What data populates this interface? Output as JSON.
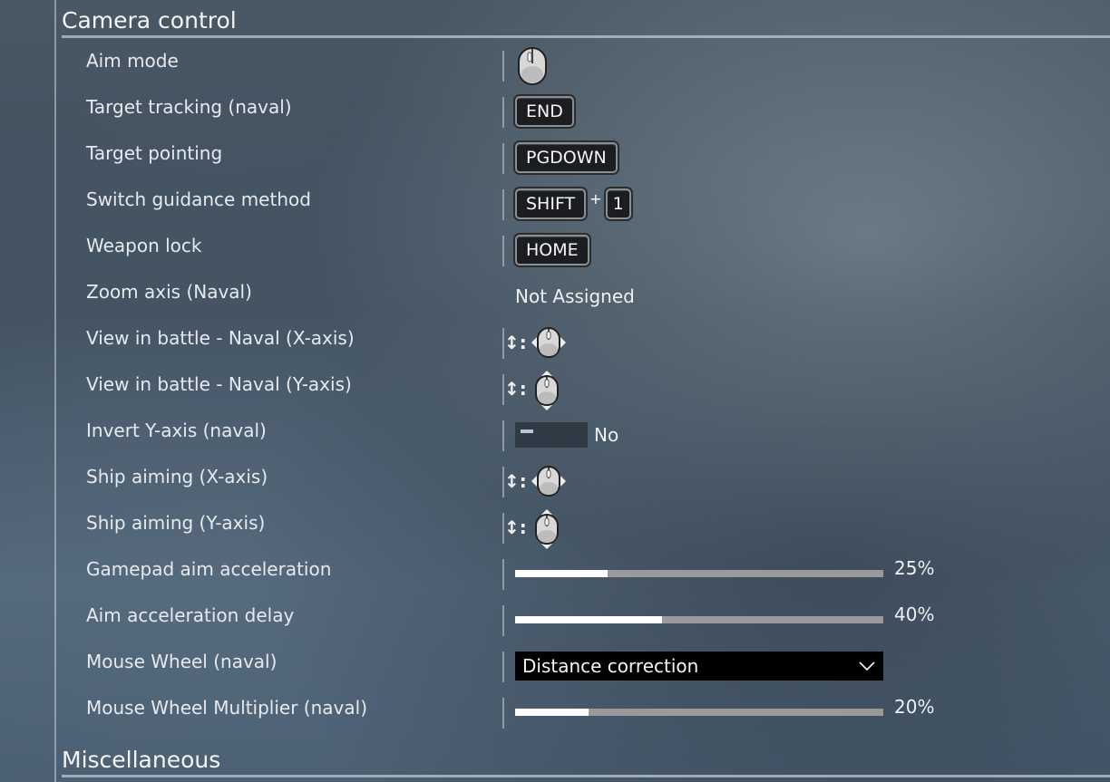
{
  "sections": {
    "camera_control": "Camera control",
    "miscellaneous": "Miscellaneous"
  },
  "rows": [
    {
      "label": "Aim mode",
      "type": "mouse",
      "icon": "mouse-icon"
    },
    {
      "label": "Target tracking (naval)",
      "type": "key",
      "keys": [
        "END"
      ]
    },
    {
      "label": "Target pointing",
      "type": "key",
      "keys": [
        "PGDOWN"
      ]
    },
    {
      "label": "Switch guidance method",
      "type": "combo",
      "keys": [
        "SHIFT",
        "1"
      ],
      "plus": "+"
    },
    {
      "label": "Weapon lock",
      "type": "key",
      "keys": [
        "HOME"
      ]
    },
    {
      "label": "Zoom axis (Naval)",
      "type": "text",
      "value": "Not Assigned"
    },
    {
      "label": "View in battle - Naval (X-axis)",
      "type": "axis",
      "prefix": "↕:",
      "icon": "mouse-horizontal-icon"
    },
    {
      "label": "View in battle - Naval (Y-axis)",
      "type": "axis",
      "prefix": "↕:",
      "icon": "mouse-vertical-icon"
    },
    {
      "label": "Invert Y-axis (naval)",
      "type": "toggle",
      "value": "No"
    },
    {
      "label": "Ship aiming (X-axis)",
      "type": "axis",
      "prefix": "↕:",
      "icon": "mouse-horizontal-icon"
    },
    {
      "label": "Ship aiming (Y-axis)",
      "type": "axis",
      "prefix": "↕:",
      "icon": "mouse-vertical-icon"
    },
    {
      "label": "Gamepad aim acceleration",
      "type": "slider",
      "value": "25%",
      "fraction": 0.25
    },
    {
      "label": "Aim acceleration delay",
      "type": "slider",
      "value": "40%",
      "fraction": 0.4
    },
    {
      "label": "Mouse Wheel (naval)",
      "type": "dropdown",
      "value": "Distance correction"
    },
    {
      "label": "Mouse Wheel Multiplier (naval)",
      "type": "slider",
      "value": "20%",
      "fraction": 0.2
    }
  ]
}
